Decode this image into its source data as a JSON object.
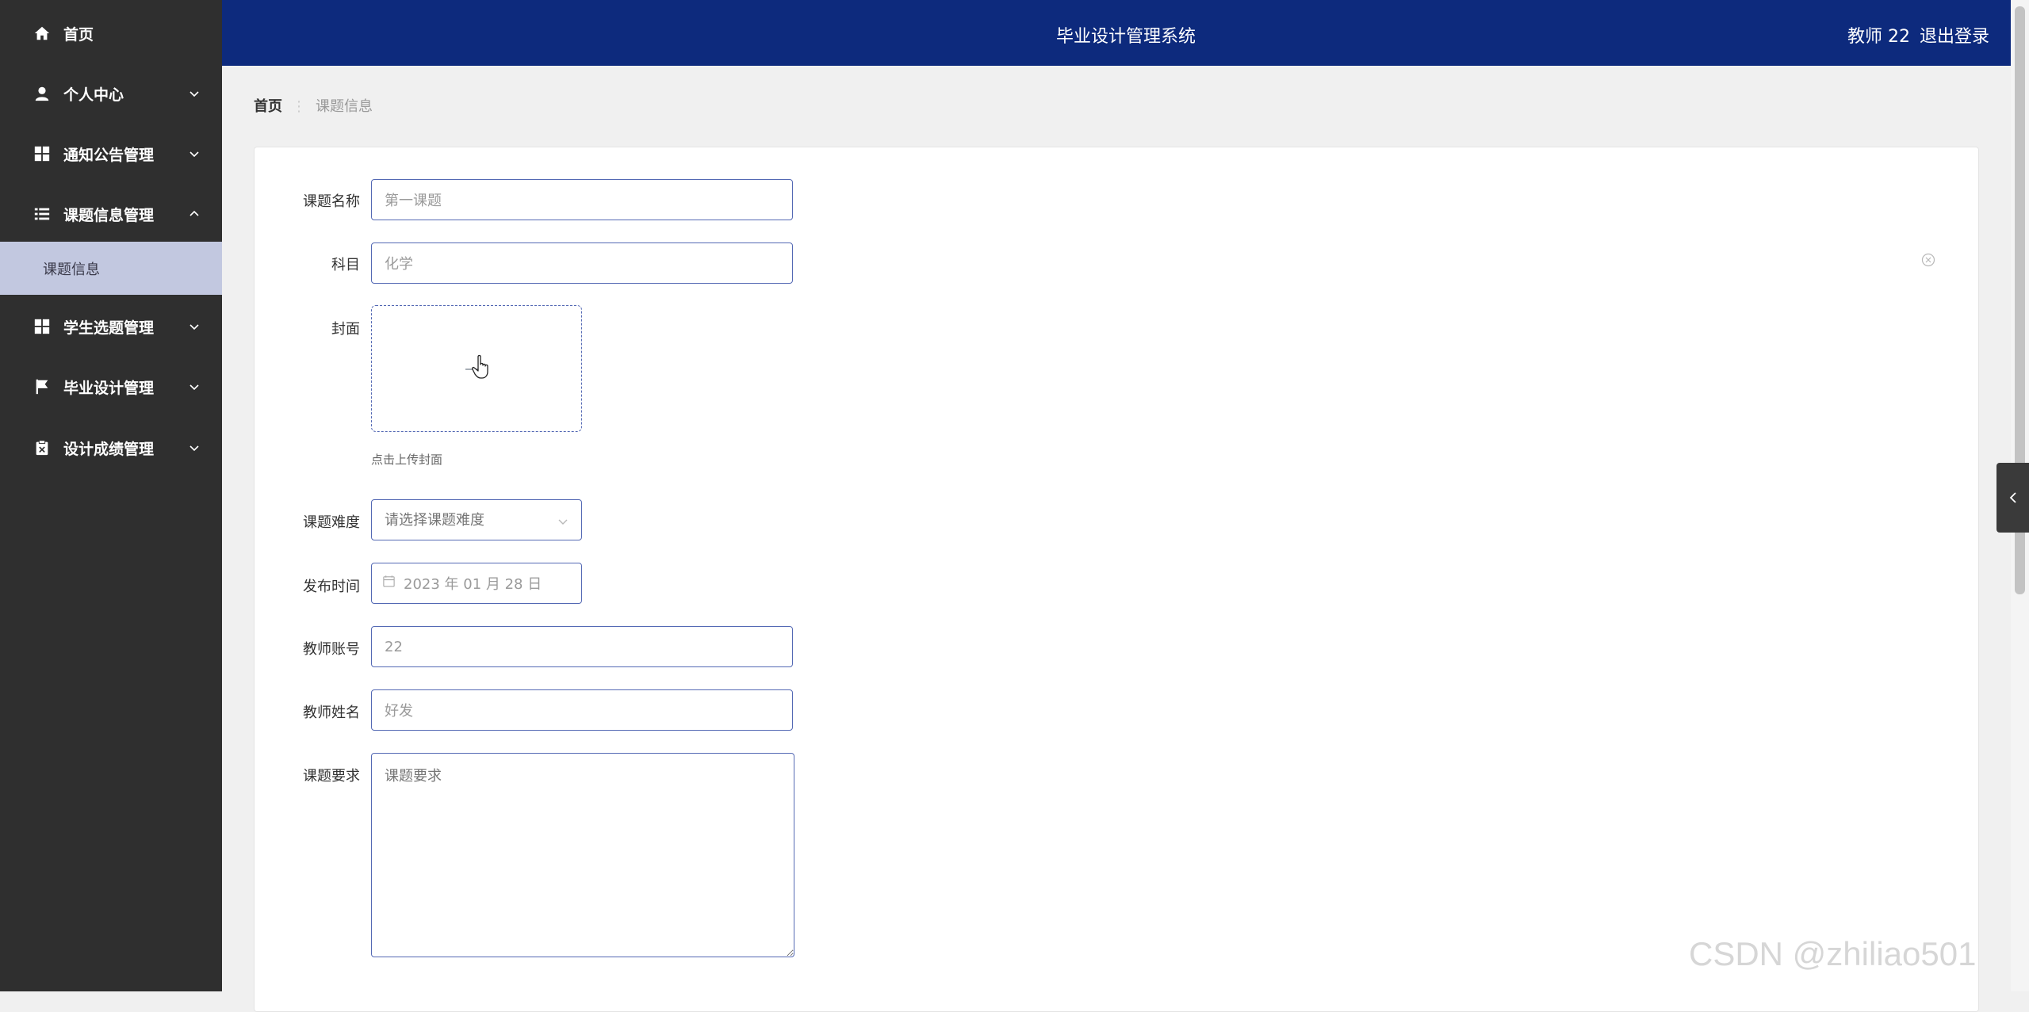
{
  "sidebar": {
    "items": [
      {
        "label": "首页",
        "icon": "home-icon"
      },
      {
        "label": "个人中心",
        "icon": "user-icon",
        "expanded": false
      },
      {
        "label": "通知公告管理",
        "icon": "grid-icon",
        "expanded": false
      },
      {
        "label": "课题信息管理",
        "icon": "list-icon",
        "expanded": true
      },
      {
        "label": "学生选题管理",
        "icon": "grid-icon",
        "expanded": false
      },
      {
        "label": "毕业设计管理",
        "icon": "flag-icon",
        "expanded": false
      },
      {
        "label": "设计成绩管理",
        "icon": "clipboard-icon",
        "expanded": false
      }
    ],
    "active_sub_item": "课题信息"
  },
  "header": {
    "title": "毕业设计管理系统",
    "user": "教师 22",
    "logout": "退出登录"
  },
  "breadcrumb": {
    "home": "首页",
    "separator": "⋮",
    "current": "课题信息"
  },
  "form": {
    "topic_name": {
      "label": "课题名称",
      "value": "第一课题"
    },
    "subject": {
      "label": "科目",
      "value": "化学"
    },
    "cover": {
      "label": "封面",
      "tip": "点击上传封面"
    },
    "difficulty": {
      "label": "课题难度",
      "placeholder": "请选择课题难度"
    },
    "publish_time": {
      "label": "发布时间",
      "value": "2023 年 01 月 28 日"
    },
    "teacher_account": {
      "label": "教师账号",
      "value": "22"
    },
    "teacher_name": {
      "label": "教师姓名",
      "value": "好发"
    },
    "requirement": {
      "label": "课题要求",
      "placeholder": "课题要求"
    }
  },
  "watermark": "CSDN @zhiliao501",
  "colors": {
    "sidebar_bg": "#2f2f2f",
    "header_bg": "#0d2a7d",
    "active_sub_bg": "#c2c8e0",
    "input_border": "#5469b4"
  }
}
